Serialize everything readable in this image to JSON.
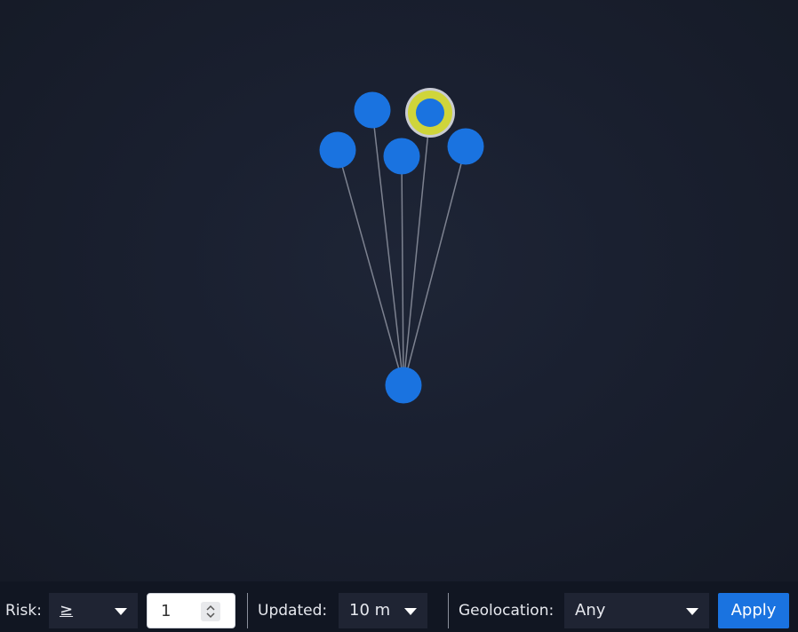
{
  "graph": {
    "nodes": [
      {
        "id": "root",
        "highlighted": false
      },
      {
        "id": "child-1",
        "highlighted": false
      },
      {
        "id": "child-2",
        "highlighted": false
      },
      {
        "id": "child-3",
        "highlighted": false
      },
      {
        "id": "child-4",
        "highlighted": true
      },
      {
        "id": "child-5",
        "highlighted": false
      }
    ],
    "edges": [
      {
        "from": "child-1",
        "to": "root"
      },
      {
        "from": "child-2",
        "to": "root"
      },
      {
        "from": "child-3",
        "to": "root"
      },
      {
        "from": "child-4",
        "to": "root"
      },
      {
        "from": "child-5",
        "to": "root"
      }
    ],
    "colors": {
      "node_fill": "#1a73e0",
      "edge": "#7d8290",
      "highlight_ring": "#cfd53a",
      "highlight_outer": "#c9cbd2"
    }
  },
  "toolbar": {
    "risk_label": "Risk:",
    "risk_operator": "≥",
    "risk_value": "1",
    "updated_label": "Updated:",
    "updated_value": "10 m",
    "geolocation_label": "Geolocation:",
    "geolocation_value": "Any",
    "apply_label": "Apply",
    "accent": "#1a73e0"
  }
}
